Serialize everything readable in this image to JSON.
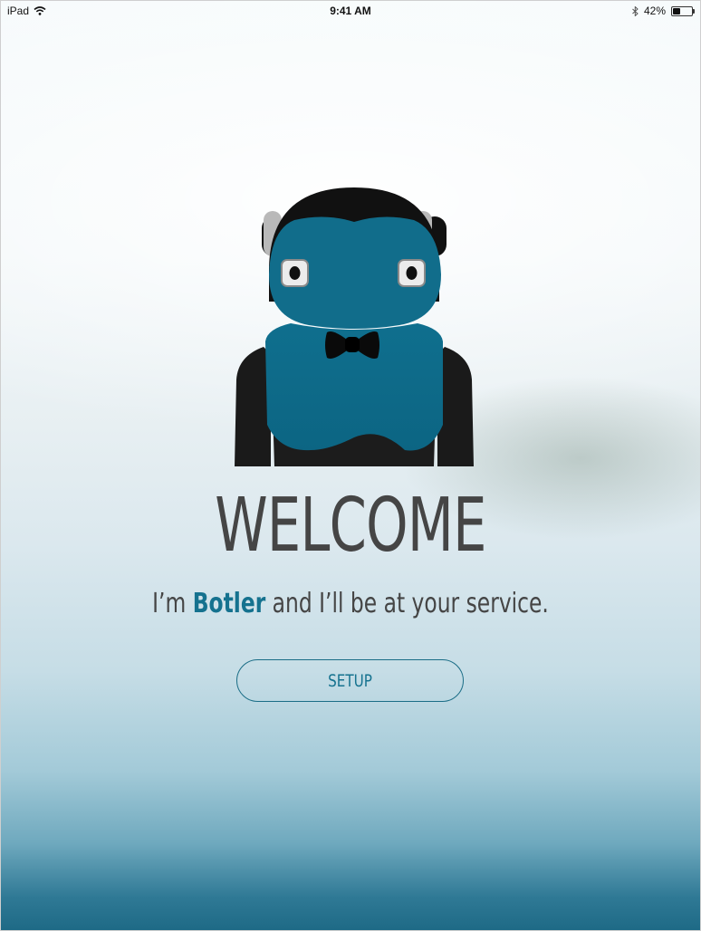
{
  "status_bar": {
    "device": "iPad",
    "time": "9:41 AM",
    "battery_percent_label": "42%",
    "battery_level": 0.42,
    "icons": [
      "wifi-icon",
      "bluetooth-icon",
      "battery-icon"
    ]
  },
  "welcome": {
    "title": "WELCOME",
    "tagline_prefix": "I’m ",
    "bot_name": "Botler",
    "tagline_suffix": " and I’ll be at your service.",
    "setup_label": "SETUP"
  },
  "colors": {
    "accent": "#15728f",
    "robot_body": "#0f6f8e",
    "robot_dark": "#1a1a1a",
    "text": "#454545"
  }
}
